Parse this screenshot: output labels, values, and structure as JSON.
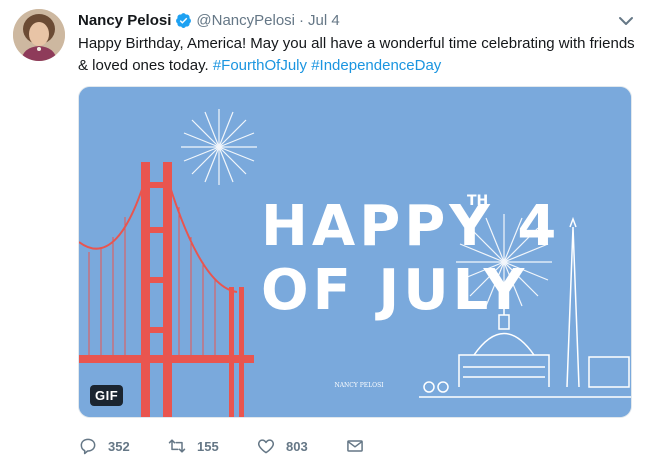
{
  "user": {
    "display_name": "Nancy Pelosi",
    "handle": "@NancyPelosi",
    "separator": "·",
    "timestamp": "Jul 4",
    "verified": true
  },
  "tweet": {
    "text_plain": "Happy Birthday, America! May you all have a wonderful time celebrating with friends & loved ones today. ",
    "hashtags": [
      "#FourthOfJuly",
      "#IndependenceDay"
    ]
  },
  "media": {
    "type": "GIF",
    "badge_label": "GIF",
    "headline_line1": "HAPPY 4",
    "headline_superscript": "TH",
    "headline_line2": "OF JULY",
    "watermark": "NANCY PELOSI",
    "colors": {
      "sky": "#7aa9dc",
      "bridge": "#e9554f",
      "white": "#ffffff"
    }
  },
  "actions": {
    "replies": "352",
    "retweets": "155",
    "likes": "803"
  },
  "icons": {
    "avatar": "profile-photo",
    "verified": "verified-badge-icon",
    "caret": "chevron-down-icon",
    "reply": "reply-icon",
    "retweet": "retweet-icon",
    "like": "heart-icon",
    "message": "envelope-icon"
  }
}
